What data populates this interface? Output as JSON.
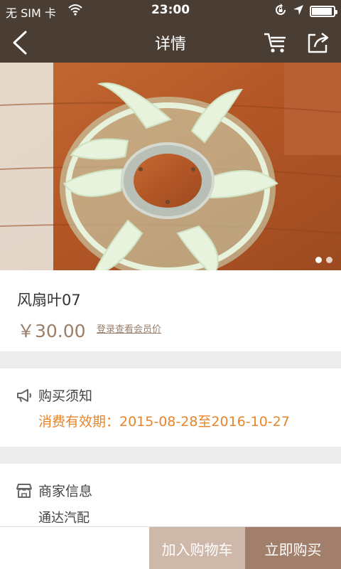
{
  "status_bar": {
    "carrier": "无 SIM 卡",
    "time": "23:00",
    "icons": [
      "wifi-icon",
      "rotation-lock-icon",
      "location-arrow-icon",
      "battery-icon"
    ],
    "battery_level": 0.95
  },
  "nav": {
    "title": "详情",
    "back_icon": "chevron-left-icon",
    "cart_icon": "cart-icon",
    "share_icon": "share-icon"
  },
  "gallery": {
    "image": "fan-blade-photo",
    "page_count": 2,
    "current_page": 1
  },
  "product": {
    "name": "风扇叶07",
    "price": "￥30.00",
    "member_price_link": "登录查看会员价"
  },
  "purchase_notice": {
    "icon": "megaphone-icon",
    "title": "购买须知",
    "validity": "消费有效期：2015-08-28至2016-10-27"
  },
  "merchant": {
    "icon": "store-icon",
    "title": "商家信息",
    "name": "通达汽配"
  },
  "actions": {
    "add_to_cart": "加入购物车",
    "buy_now": "立即购买"
  },
  "colors": {
    "header_bg": "#4a3d33",
    "price": "#9a7e68",
    "validity": "#e8852b",
    "add_to_cart_bg": "#cdb8aa",
    "buy_now_bg": "#a17f6a"
  }
}
